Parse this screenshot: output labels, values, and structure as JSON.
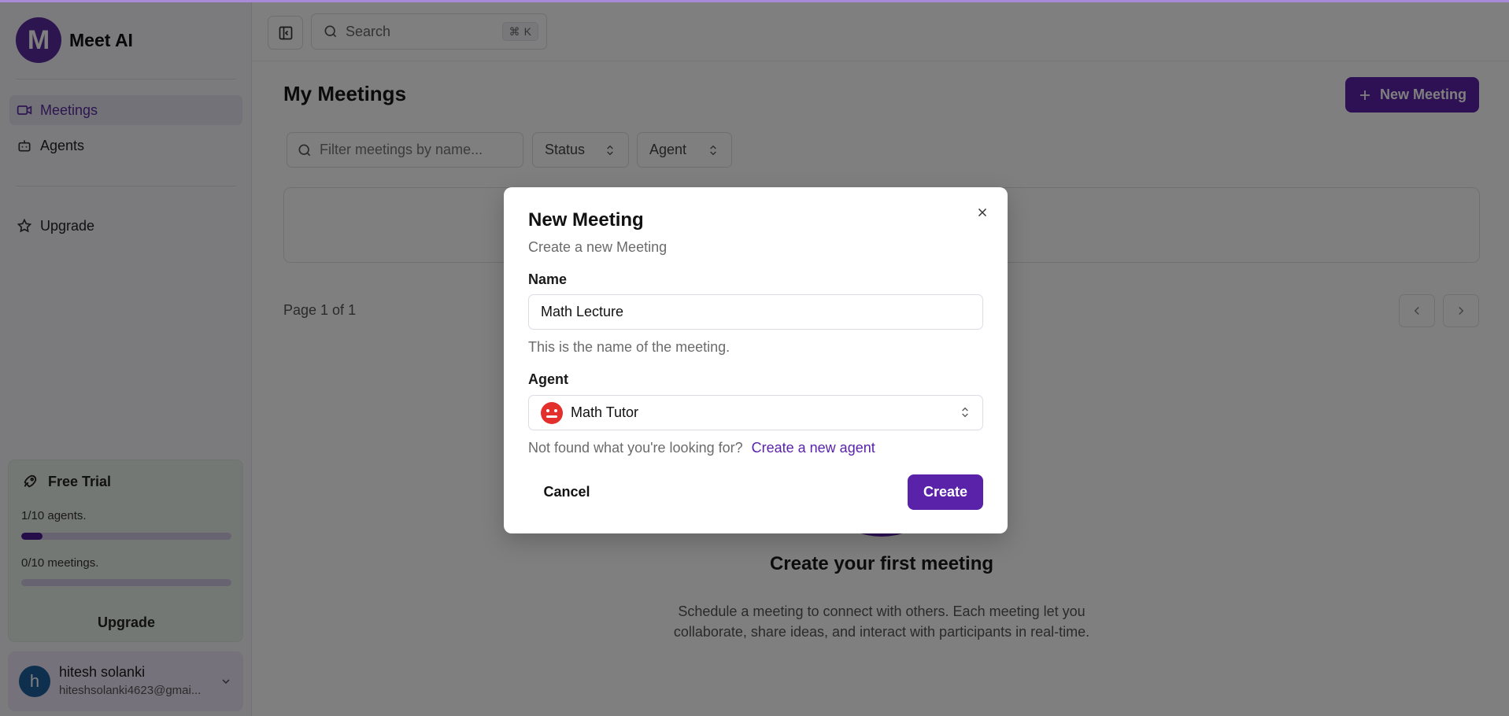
{
  "app": {
    "name": "Meet AI",
    "logo_letter": "M"
  },
  "sidebar": {
    "items": [
      {
        "label": "Meetings",
        "icon": "video-icon",
        "active": true
      },
      {
        "label": "Agents",
        "icon": "bot-icon",
        "active": false
      },
      {
        "label": "Upgrade",
        "icon": "star-icon",
        "active": false
      }
    ],
    "trial": {
      "title": "Free Trial",
      "agents_text": "1/10 agents.",
      "agents_progress": 0.1,
      "meetings_text": "0/10 meetings.",
      "meetings_progress": 0,
      "upgrade_label": "Upgrade"
    },
    "user": {
      "initial": "h",
      "name": "hitesh solanki",
      "email": "hiteshsolanki4623@gmai..."
    }
  },
  "topbar": {
    "search_placeholder": "Search",
    "shortcut_key": "K",
    "shortcut_symbol": "⌘"
  },
  "main": {
    "title": "My Meetings",
    "new_meeting_label": "New Meeting",
    "filter_placeholder": "Filter meetings by name...",
    "status_filter": "Status",
    "agent_filter": "Agent",
    "page_label": "Page 1 of 1",
    "empty_title": "Create your first meeting",
    "empty_desc_line1": "Schedule a meeting to connect with others. Each meeting let you",
    "empty_desc_line2": "collaborate, share ideas, and interact with participants in real-time."
  },
  "modal": {
    "title": "New Meeting",
    "subtitle": "Create a new Meeting",
    "name_label": "Name",
    "name_value": "Math Lecture",
    "name_help": "This is the name of the meeting.",
    "agent_label": "Agent",
    "agent_value": "Math Tutor",
    "not_found_text": "Not found what you're looking for?",
    "create_agent_link": "Create a new agent",
    "cancel_label": "Cancel",
    "create_label": "Create"
  },
  "colors": {
    "brand": "#5a22a8",
    "overlay": "rgba(0,0,0,0.5)",
    "agent_avatar": "#e4302c",
    "user_avatar": "#1d5f9c"
  }
}
